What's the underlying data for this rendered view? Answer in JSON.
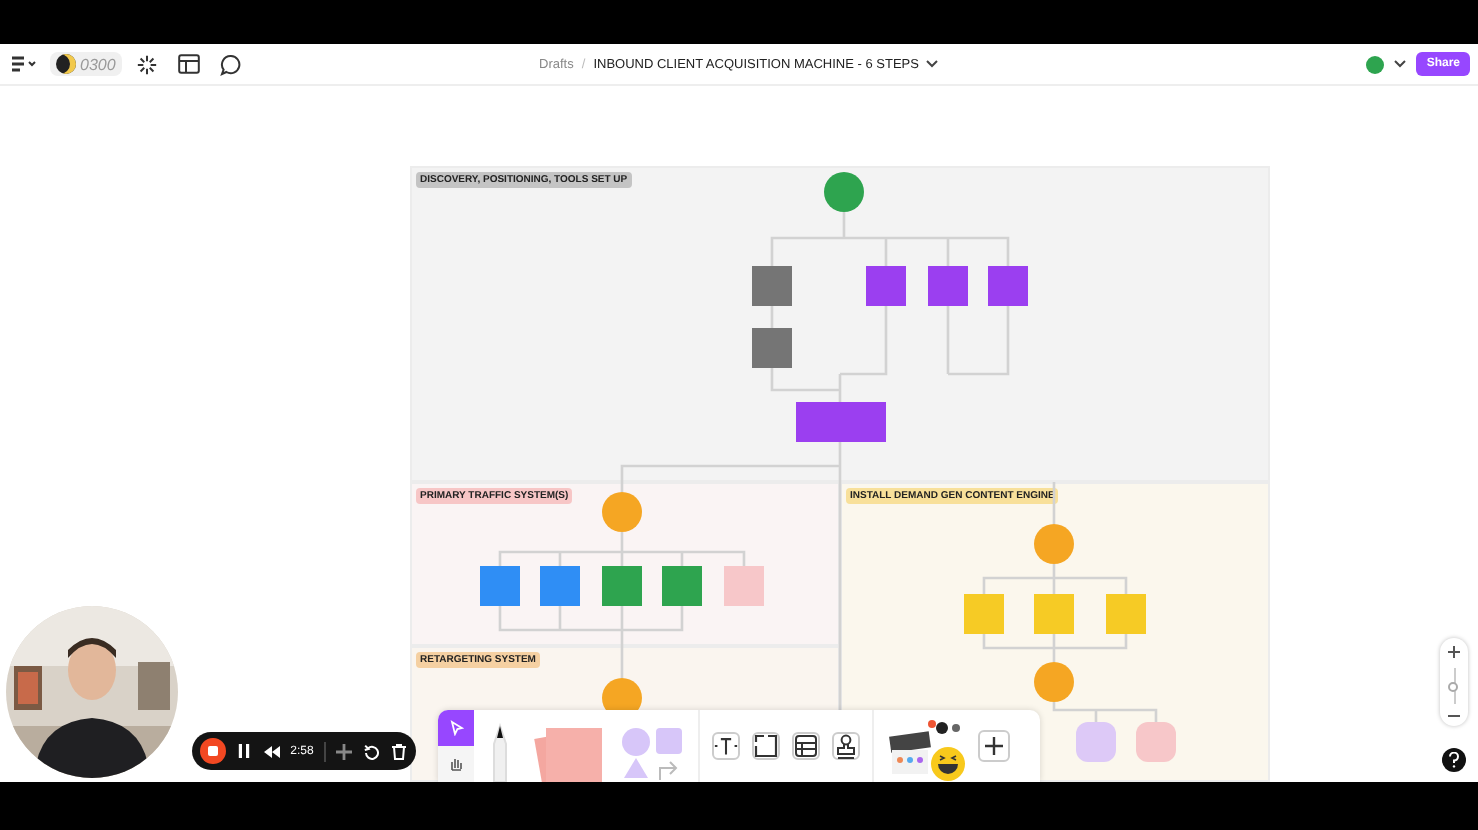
{
  "top_bar": {
    "timer": "0300",
    "breadcrumb": "Drafts",
    "separator": "/",
    "title": "INBOUND CLIENT ACQUISITION MACHINE - 6 STEPS",
    "share": "Share"
  },
  "board_sections": [
    {
      "label": "DISCOVERY, POSITIONING, TOOLS SET UP",
      "color": "#c4c4c4"
    },
    {
      "label": "PRIMARY TRAFFIC SYSTEM(S)",
      "color": "#f7c6c6"
    },
    {
      "label": "INSTALL DEMAND GEN CONTENT ENGINE",
      "color": "#f8e09a"
    },
    {
      "label": "RETARGETING SYSTEM",
      "color": "#f5d0a2"
    }
  ],
  "zoom": {
    "level": 0.5
  },
  "recording": {
    "time": "2:58"
  }
}
